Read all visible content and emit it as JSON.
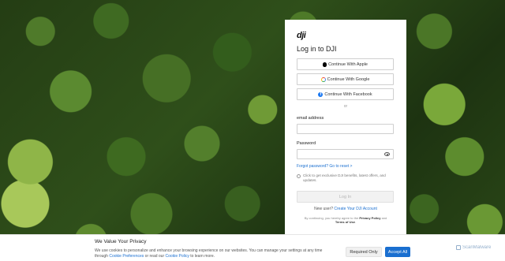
{
  "background": {
    "name": "forest-aerial-background"
  },
  "login": {
    "logo": "dji",
    "title": "Log in to DJI",
    "sso": [
      {
        "label": "Continue With Apple",
        "icon": "apple-icon"
      },
      {
        "label": "Continue With Google",
        "icon": "google-icon"
      },
      {
        "label": "Continue With Facebook",
        "icon": "facebook-icon"
      }
    ],
    "or": "or",
    "email_label": "email address",
    "email_value": "",
    "password_label": "Password",
    "password_value": "",
    "forgot": "Forgot password? Go to reset >",
    "consent": "Click to get exclusive DJI benefits, latest offers, and updates.",
    "login_button": "Log In",
    "new_user_prefix": "New user?",
    "create_account": "Create Your DJI Account",
    "terms_prefix": "By continuing, you hereby agree to the",
    "privacy_policy": "Privacy Policy",
    "terms_and": "and",
    "terms_of_use": "Terms of Use",
    "terms_suffix": "."
  },
  "cookie": {
    "title": "We Value Your Privacy",
    "text_1": "We use cookies to personalize and enhance your browsing experience on our websites. You can manage your settings at any time through",
    "cookie_preferences": "Cookie Preferences",
    "text_2": "or read our",
    "cookie_policy": "Cookie Policy",
    "text_3": "to learn more.",
    "required_only": "Required Only",
    "accept_all": "Accept All"
  },
  "watermark": {
    "text": "ScanMalware"
  },
  "colors": {
    "accent": "#1a6fd0",
    "facebook": "#1877f2"
  }
}
